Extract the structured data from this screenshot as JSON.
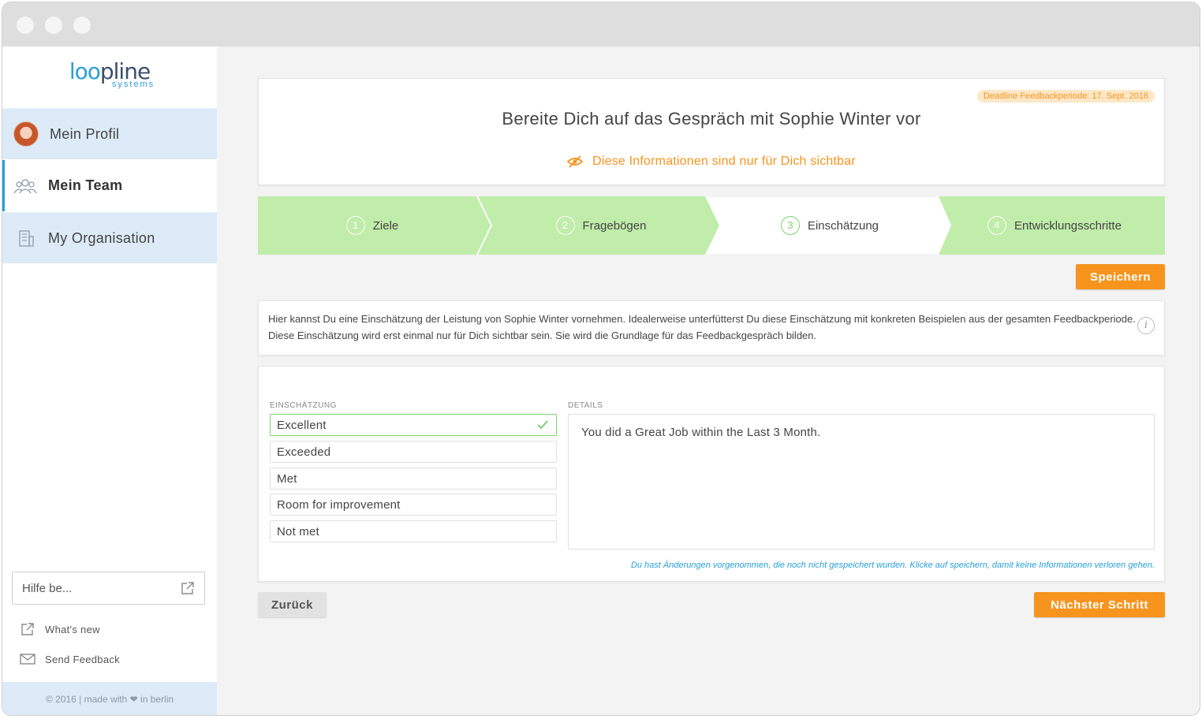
{
  "brand": {
    "logo_main_prefix": "loo",
    "logo_main_rest": "pline",
    "logo_sub": "systems"
  },
  "sidebar": {
    "items": [
      {
        "label": "Mein Profil",
        "icon": "avatar"
      },
      {
        "label": "Mein Team",
        "icon": "team-icon",
        "active": true
      },
      {
        "label": "My Organisation",
        "icon": "building-icon"
      }
    ],
    "help_placeholder": "Hilfe be...",
    "links": [
      {
        "label": "What's new",
        "icon": "external-link-icon"
      },
      {
        "label": "Send Feedback",
        "icon": "envelope-icon"
      }
    ],
    "footer": "© 2016 | made with ❤ in berlin"
  },
  "header": {
    "deadline": "Deadline Feedbackperiode: 17. Sept. 2016",
    "title": "Bereite Dich auf das Gespräch mit Sophie Winter vor",
    "visibility_note": "Diese Informationen sind nur für Dich sichtbar"
  },
  "steps": [
    {
      "number": "1",
      "label": "Ziele",
      "state": "done"
    },
    {
      "number": "2",
      "label": "Fragebögen",
      "state": "done"
    },
    {
      "number": "3",
      "label": "Einschätzung",
      "state": "current"
    },
    {
      "number": "4",
      "label": "Entwicklungsschritte",
      "state": "done"
    }
  ],
  "buttons": {
    "save": "Speichern",
    "back": "Zurück",
    "next": "Nächster Schritt"
  },
  "description": "Hier kannst Du eine Einschätzung der Leistung von Sophie Winter vornehmen. Idealerweise unterfütterst Du diese Einschätzung mit konkreten Beispielen aus der gesamten Feedbackperiode. Diese Einschätzung wird erst einmal nur für Dich sichtbar sein. Sie wird die Grundlage für das Feedbackgespräch bilden.",
  "assessment": {
    "label": "EINSCHÄTZUNG",
    "options": [
      "Excellent",
      "Exceeded",
      "Met",
      "Room for improvement",
      "Not met"
    ],
    "selected": "Excellent"
  },
  "details": {
    "label": "DETAILS",
    "value": "You did a Great Job within the Last 3 Month.",
    "unsaved_notice": "Du hast Änderungen vorgenommen, die noch nicht gespeichert wurden. Klicke auf speichern, damit keine Informationen verloren gehen."
  },
  "colors": {
    "accent": "#f7941d",
    "step_done": "#c0edaa",
    "link_blue": "#2a9fd8",
    "nav_blue": "#dcebf7"
  }
}
